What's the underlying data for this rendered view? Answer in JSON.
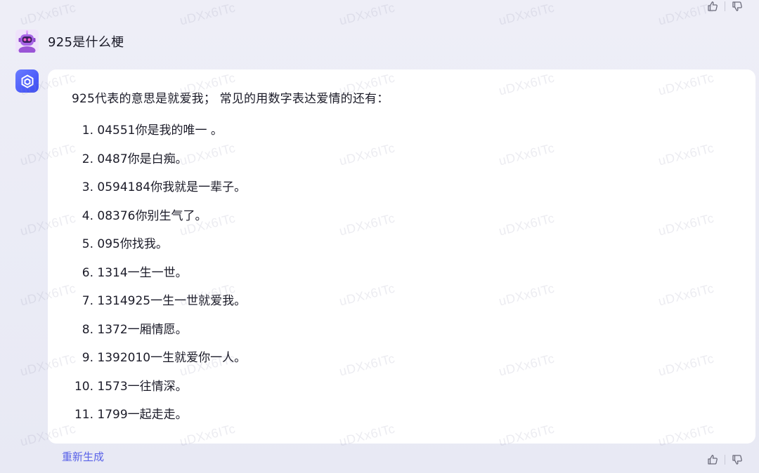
{
  "conversation": {
    "user_question": "925是什么梗",
    "answer_intro": "925代表的意思是就爱我； 常见的用数字表达爱情的还有：",
    "answer_items": [
      {
        "num": "1.",
        "text": "04551你是我的唯一 。"
      },
      {
        "num": "2.",
        "text": "0487你是白痴。"
      },
      {
        "num": "3.",
        "text": "0594184你我就是一辈子。"
      },
      {
        "num": "4.",
        "text": "08376你别生气了。"
      },
      {
        "num": "5.",
        "text": "095你找我。"
      },
      {
        "num": "6.",
        "text": "1314一生一世。"
      },
      {
        "num": "7.",
        "text": "1314925一生一世就爱我。"
      },
      {
        "num": "8.",
        "text": "1372一厢情愿。"
      },
      {
        "num": "9.",
        "text": "1392010一生就爱你一人。"
      },
      {
        "num": "10.",
        "text": "1573一往情深。"
      },
      {
        "num": "11.",
        "text": "1799一起走走。"
      }
    ],
    "regenerate_label": "重新生成"
  },
  "watermark_text": "uDXx6ITc",
  "icons": {
    "user_avatar": "robot-avatar-icon",
    "bot_avatar": "cube-logo-icon",
    "like": "thumbs-up-icon",
    "dislike": "thumbs-down-icon"
  },
  "colors": {
    "accent": "#5a63e8",
    "bot_avatar": "#4d5dfa",
    "card_bg": "#ffffff",
    "page_bg": "#ecedf6"
  }
}
